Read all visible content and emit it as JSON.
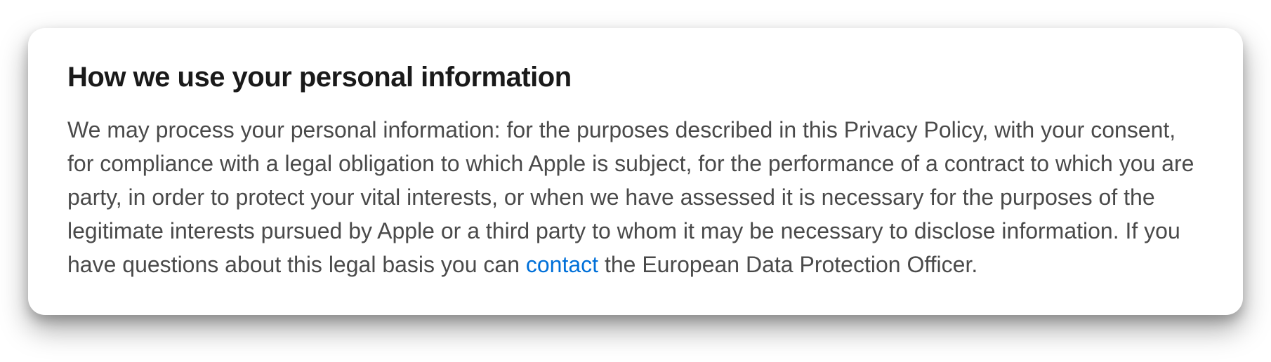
{
  "section": {
    "heading": "How we use your personal information",
    "body_before_link": "We may process your personal information: for the purposes described in this Privacy Policy, with your consent, for compliance with a legal obligation to which Apple is subject, for the performance of a contract to which you are party, in order to protect your vital interests, or when we have assessed it is necessary for the purposes of the legitimate interests pursued by Apple or a third party to whom it may be necessary to disclose information. If you have questions about this legal basis you can ",
    "link_text": "contact",
    "body_after_link": " the European Data Protection Officer."
  }
}
